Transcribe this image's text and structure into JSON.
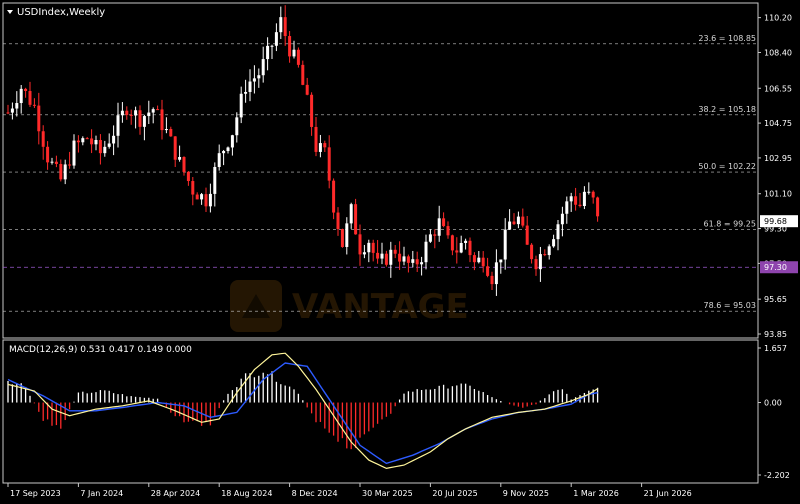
{
  "chart_data": {
    "type": "candlestick",
    "symbol_title": "USDIndex,Weekly",
    "colors": {
      "background": "#000000",
      "frame": "#c8c8c8",
      "bull_candle": "#ffffff",
      "bear_candle": "#ff2a2a",
      "fib_line": "#c8c8c8",
      "marker_line": "#9b59d0",
      "current_price_tag": "#ffffff",
      "marker_price_tag": "#8e44ad",
      "macd_hist_pos": "#ffffff",
      "macd_hist_neg": "#ff2a2a",
      "macd_line": "#fff59a",
      "signal_line": "#2d5bff"
    },
    "price_axis": {
      "ylim": [
        93.85,
        110.75
      ],
      "ticks": [
        "110.20",
        "108.40",
        "106.55",
        "104.75",
        "102.95",
        "101.10",
        "99.30",
        "97.50",
        "95.65",
        "93.85"
      ],
      "tick_values": [
        110.2,
        108.4,
        106.55,
        104.75,
        102.95,
        101.1,
        99.3,
        97.5,
        95.65,
        93.85
      ]
    },
    "fib_levels": [
      {
        "label": "23.6 = 108.85",
        "value": 108.85
      },
      {
        "label": "38.2 = 105.18",
        "value": 105.18
      },
      {
        "label": "50.0 = 102.22",
        "value": 102.22
      },
      {
        "label": "61.8 = 99.25",
        "value": 99.25
      },
      {
        "label": "78.6 = 95.03",
        "value": 95.03
      }
    ],
    "current_price": {
      "label": "99.68",
      "value": 99.68
    },
    "marker_level": {
      "label": "97.30",
      "value": 97.3
    },
    "x_axis": {
      "labels": [
        "17 Sep 2023",
        "7 Jan 2024",
        "28 Apr 2024",
        "18 Aug 2024",
        "8 Dec 2024",
        "30 Mar 2025",
        "20 Jul 2025",
        "9 Nov 2025",
        "1 Mar 2026",
        "21 Jun 2026"
      ],
      "label_bar_index": [
        0,
        16,
        32,
        48,
        64,
        80,
        96,
        112,
        128,
        144
      ]
    },
    "close_path": {
      "note_free": true,
      "anchors": [
        [
          0,
          105.3
        ],
        [
          3,
          106.6
        ],
        [
          6,
          105.6
        ],
        [
          9,
          103.0
        ],
        [
          12,
          101.8
        ],
        [
          15,
          103.5
        ],
        [
          18,
          104.0
        ],
        [
          21,
          103.2
        ],
        [
          24,
          104.3
        ],
        [
          27,
          105.6
        ],
        [
          30,
          105.0
        ],
        [
          33,
          105.5
        ],
        [
          36,
          104.3
        ],
        [
          39,
          102.7
        ],
        [
          42,
          101.3
        ],
        [
          45,
          100.8
        ],
        [
          48,
          103.0
        ],
        [
          51,
          104.3
        ],
        [
          54,
          106.7
        ],
        [
          57,
          107.3
        ],
        [
          60,
          108.8
        ],
        [
          62,
          110.0
        ],
        [
          64,
          108.6
        ],
        [
          66,
          107.6
        ],
        [
          68,
          105.8
        ],
        [
          70,
          103.5
        ],
        [
          72,
          103.2
        ],
        [
          74,
          100.5
        ],
        [
          76,
          98.5
        ],
        [
          78,
          100.2
        ],
        [
          80,
          98.3
        ],
        [
          82,
          98.7
        ],
        [
          84,
          97.4
        ],
        [
          86,
          97.8
        ],
        [
          88,
          98.2
        ],
        [
          90,
          97.6
        ],
        [
          92,
          97.3
        ],
        [
          94,
          97.9
        ],
        [
          96,
          98.9
        ],
        [
          98,
          99.6
        ],
        [
          100,
          98.6
        ],
        [
          102,
          98.2
        ],
        [
          104,
          98.7
        ],
        [
          106,
          97.5
        ],
        [
          108,
          97.8
        ],
        [
          110,
          96.8
        ],
        [
          112,
          98.0
        ],
        [
          114,
          99.6
        ],
        [
          116,
          99.8
        ],
        [
          118,
          98.3
        ],
        [
          120,
          97.6
        ],
        [
          122,
          98.3
        ],
        [
          124,
          99.1
        ],
        [
          126,
          100.1
        ],
        [
          128,
          101.0
        ],
        [
          130,
          100.5
        ],
        [
          131,
          101.2
        ],
        [
          133,
          100.7
        ],
        [
          134,
          99.7
        ]
      ]
    },
    "macd": {
      "label": "MACD(12,26,9) 0.531 0.417 0.149 0.000",
      "ylim": [
        -2.202,
        1.657
      ],
      "ticks": [
        "1.657",
        "0.00",
        "-2.202"
      ],
      "tick_values": [
        1.657,
        0.0,
        -2.202
      ],
      "line_anchors": [
        [
          0,
          0.55
        ],
        [
          6,
          0.35
        ],
        [
          10,
          -0.2
        ],
        [
          14,
          -0.4
        ],
        [
          20,
          -0.2
        ],
        [
          26,
          -0.1
        ],
        [
          32,
          0.05
        ],
        [
          38,
          -0.25
        ],
        [
          44,
          -0.6
        ],
        [
          48,
          -0.5
        ],
        [
          52,
          0.3
        ],
        [
          56,
          1.0
        ],
        [
          60,
          1.45
        ],
        [
          63,
          1.5
        ],
        [
          66,
          1.1
        ],
        [
          70,
          0.4
        ],
        [
          74,
          -0.4
        ],
        [
          78,
          -1.2
        ],
        [
          82,
          -1.75
        ],
        [
          86,
          -2.0
        ],
        [
          90,
          -1.9
        ],
        [
          96,
          -1.5
        ],
        [
          100,
          -1.1
        ],
        [
          104,
          -0.8
        ],
        [
          110,
          -0.45
        ],
        [
          116,
          -0.3
        ],
        [
          122,
          -0.2
        ],
        [
          128,
          0.05
        ],
        [
          132,
          0.25
        ],
        [
          134,
          0.42
        ]
      ],
      "signal_anchors": [
        [
          0,
          0.7
        ],
        [
          8,
          0.2
        ],
        [
          14,
          -0.25
        ],
        [
          20,
          -0.25
        ],
        [
          26,
          -0.15
        ],
        [
          34,
          0.0
        ],
        [
          40,
          -0.1
        ],
        [
          46,
          -0.45
        ],
        [
          52,
          -0.3
        ],
        [
          58,
          0.7
        ],
        [
          63,
          1.2
        ],
        [
          68,
          1.1
        ],
        [
          72,
          0.3
        ],
        [
          76,
          -0.5
        ],
        [
          80,
          -1.3
        ],
        [
          86,
          -1.85
        ],
        [
          92,
          -1.6
        ],
        [
          98,
          -1.25
        ],
        [
          104,
          -0.8
        ],
        [
          110,
          -0.5
        ],
        [
          116,
          -0.3
        ],
        [
          122,
          -0.2
        ],
        [
          128,
          -0.05
        ],
        [
          132,
          0.25
        ],
        [
          134,
          0.3
        ]
      ],
      "hist_anchors": [
        [
          0,
          0.7
        ],
        [
          4,
          0.5
        ],
        [
          8,
          -0.55
        ],
        [
          12,
          -0.75
        ],
        [
          16,
          0.28
        ],
        [
          22,
          0.35
        ],
        [
          28,
          0.18
        ],
        [
          34,
          0.12
        ],
        [
          38,
          -0.45
        ],
        [
          42,
          -0.6
        ],
        [
          46,
          -0.65
        ],
        [
          50,
          0.3
        ],
        [
          54,
          0.8
        ],
        [
          58,
          1.0
        ],
        [
          62,
          0.65
        ],
        [
          66,
          0.3
        ],
        [
          70,
          -0.6
        ],
        [
          74,
          -0.95
        ],
        [
          78,
          -1.35
        ],
        [
          80,
          -1.25
        ],
        [
          84,
          -0.6
        ],
        [
          87,
          -0.3
        ],
        [
          90,
          0.3
        ],
        [
          94,
          0.4
        ],
        [
          98,
          0.45
        ],
        [
          102,
          0.55
        ],
        [
          106,
          0.45
        ],
        [
          110,
          0.15
        ],
        [
          114,
          -0.05
        ],
        [
          117,
          -0.15
        ],
        [
          120,
          -0.05
        ],
        [
          124,
          0.35
        ],
        [
          126,
          0.45
        ],
        [
          128,
          0.1
        ],
        [
          132,
          0.4
        ],
        [
          134,
          0.45
        ]
      ]
    },
    "watermark": {
      "text": "VANTAGE"
    }
  }
}
